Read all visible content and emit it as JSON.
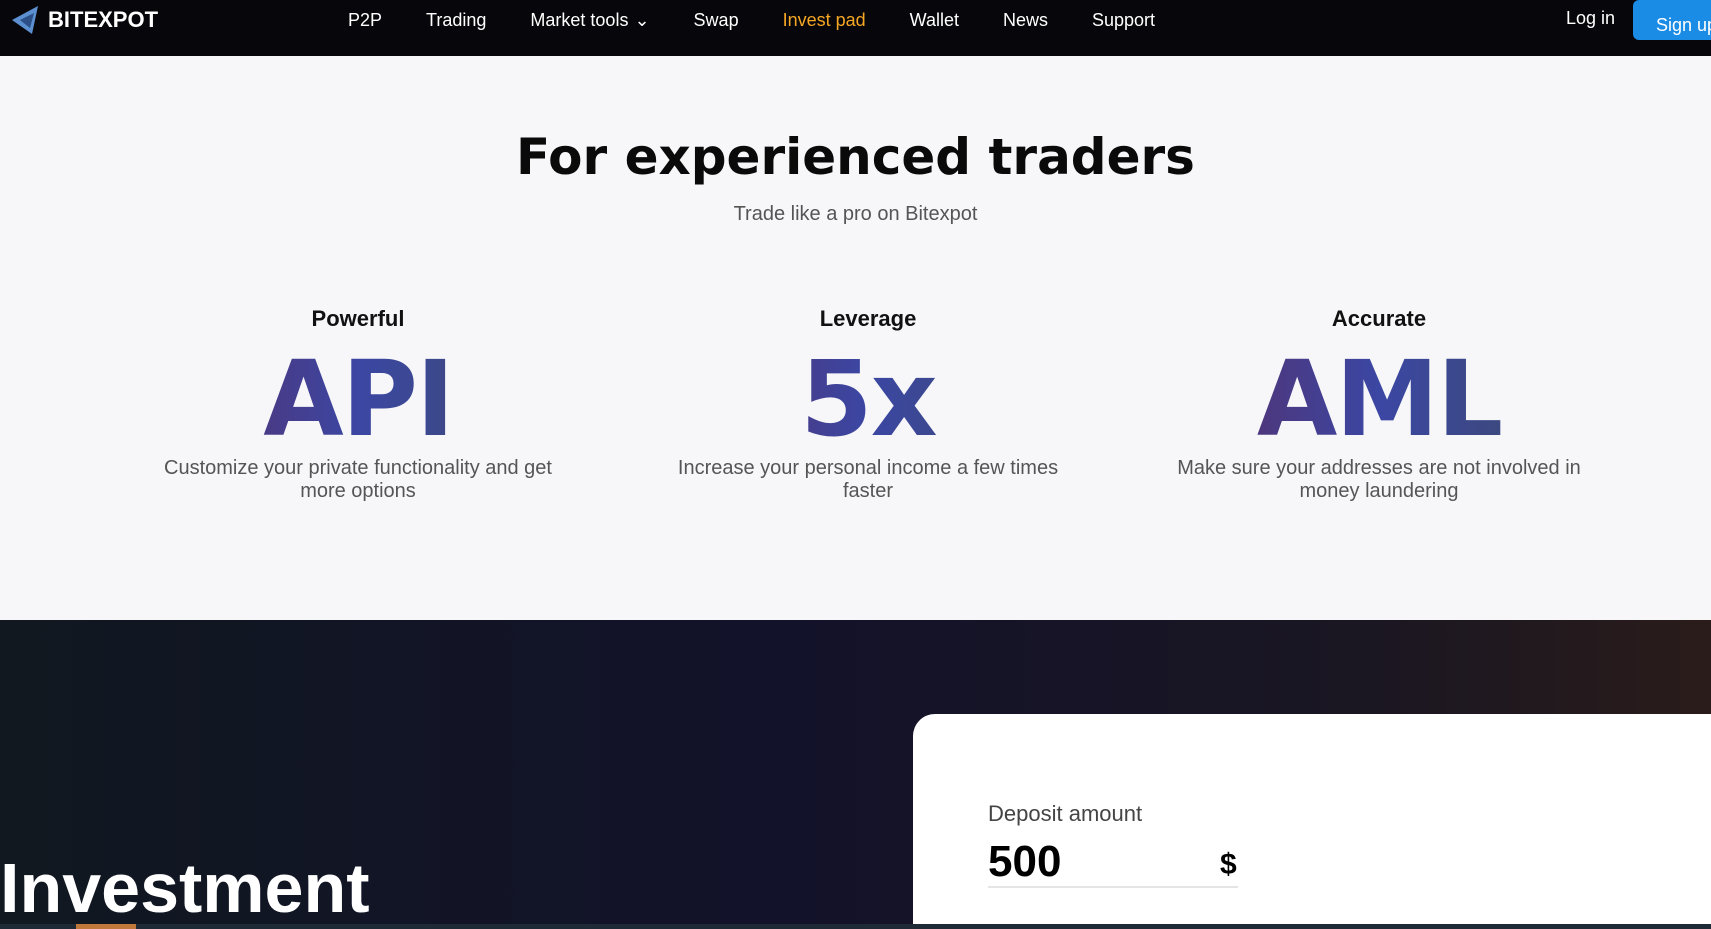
{
  "nav": {
    "brand": "BITEXPOT",
    "links": [
      "P2P",
      "Trading",
      "Market tools",
      "Swap",
      "Invest pad",
      "Wallet",
      "News",
      "Support"
    ],
    "active": "Invest pad",
    "login": "Log in",
    "signup": "Sign up"
  },
  "hero": {
    "title": "For experienced traders",
    "subtitle": "Trade like a pro on Bitexpot",
    "features": [
      {
        "label": "Powerful",
        "big": "API",
        "desc": "Customize your private functionality and get more options"
      },
      {
        "label": "Leverage",
        "big": "5x",
        "desc": "Increase your personal income a few times faster"
      },
      {
        "label": "Accurate",
        "big": "AML",
        "desc": "Make sure your addresses are not involved in money laundering"
      }
    ]
  },
  "invest": {
    "heading": "Investment",
    "deposit_label": "Deposit amount",
    "deposit_value": "500",
    "currency": "$"
  },
  "colors": {
    "accent": "#f5a623",
    "signup": "#1a8ce6"
  }
}
